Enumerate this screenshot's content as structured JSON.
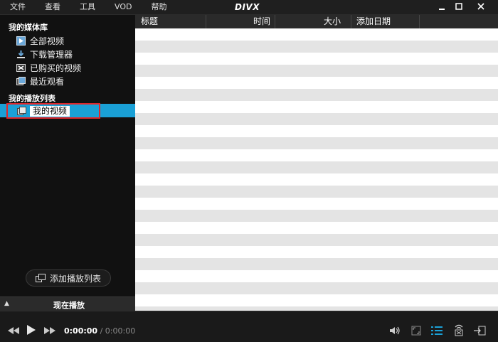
{
  "menu": [
    "文件",
    "查看",
    "工具",
    "VOD",
    "帮助"
  ],
  "app_logo": "DIVX",
  "window_controls": [
    "minimize",
    "maximize",
    "close"
  ],
  "library": {
    "heading": "我的媒体库",
    "items": [
      {
        "label": "全部视频",
        "icon": "video-icon"
      },
      {
        "label": "下载管理器",
        "icon": "download-icon"
      },
      {
        "label": "已购买的视频",
        "icon": "purchased-icon"
      },
      {
        "label": "最近观看",
        "icon": "recent-icon"
      }
    ]
  },
  "playlists": {
    "heading": "我的播放列表",
    "items": [
      {
        "label": "我的视频",
        "selected": true
      }
    ]
  },
  "add_playlist_label": "添加播放列表",
  "now_playing_label": "现在播放",
  "table": {
    "columns": [
      "标题",
      "时间",
      "大小",
      "添加日期"
    ],
    "rows": []
  },
  "player": {
    "current_time": "0:00:00",
    "separator": " / ",
    "total_time": "0:00:00"
  },
  "colors": {
    "selection": "#1aa0d6",
    "highlight_border": "#e0262a",
    "row_stripe": "#e4e4e4"
  }
}
